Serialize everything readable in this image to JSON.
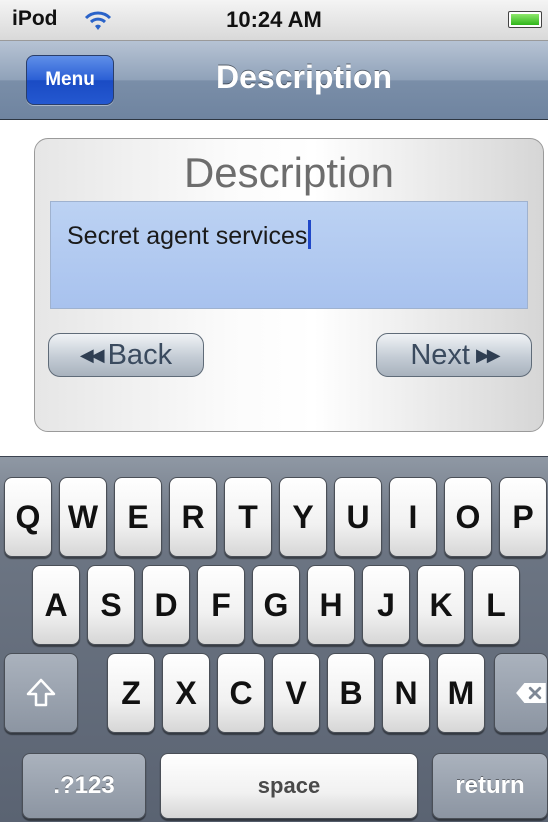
{
  "status_bar": {
    "carrier": "iPod",
    "time": "10:24 AM"
  },
  "nav": {
    "menu_label": "Menu",
    "title": "Description"
  },
  "form": {
    "heading": "Description",
    "field_value": "Secret agent services",
    "back_label": "Back",
    "next_label": "Next"
  },
  "keyboard": {
    "row1": [
      "Q",
      "W",
      "E",
      "R",
      "T",
      "Y",
      "U",
      "I",
      "O",
      "P"
    ],
    "row2": [
      "A",
      "S",
      "D",
      "F",
      "G",
      "H",
      "J",
      "K",
      "L"
    ],
    "row3": [
      "Z",
      "X",
      "C",
      "V",
      "B",
      "N",
      "M"
    ],
    "numbers_label": ".?123",
    "space_label": "space",
    "return_label": "return"
  },
  "colors": {
    "menu_button": "#2b5fd5",
    "field_highlight": "#b6cdf2",
    "nav_bar": "#90a2b9"
  },
  "icons": [
    "wifi-icon",
    "battery-icon",
    "rewind-icon",
    "fast-forward-icon",
    "shift-icon",
    "backspace-icon"
  ]
}
